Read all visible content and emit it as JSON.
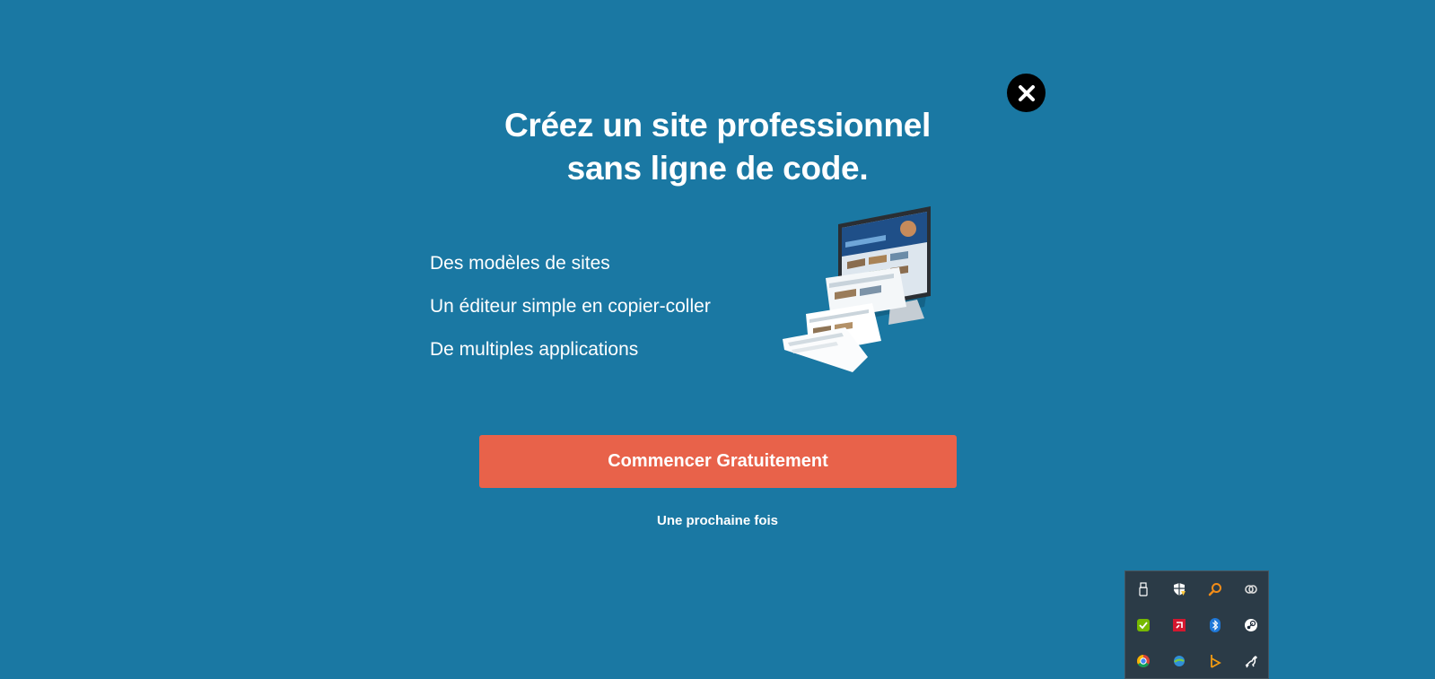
{
  "modal": {
    "headline_line1": "Créez un site professionnel",
    "headline_line2": "sans ligne de code.",
    "features": [
      "Des modèles de sites",
      "Un éditeur simple en copier-coller",
      "De multiples applications"
    ],
    "cta_label": "Commencer Gratuitement",
    "later_label": "Une prochaine fois",
    "close_icon": "close-icon",
    "illustration": "website-builder-monitor-illustration"
  },
  "colors": {
    "background": "#1a78a3",
    "cta": "#e8624a",
    "close": "#000000",
    "tray": "#2b3b47"
  },
  "system_tray": {
    "icons": [
      "usb-drive-icon",
      "security-shield-warning-icon",
      "search-magnifier-icon",
      "creative-cloud-icon",
      "nvidia-check-icon",
      "amd-icon",
      "bluetooth-icon",
      "steam-icon",
      "chrome-icon",
      "network-globe-icon",
      "media-player-icon",
      "kangaroo-icon"
    ]
  }
}
